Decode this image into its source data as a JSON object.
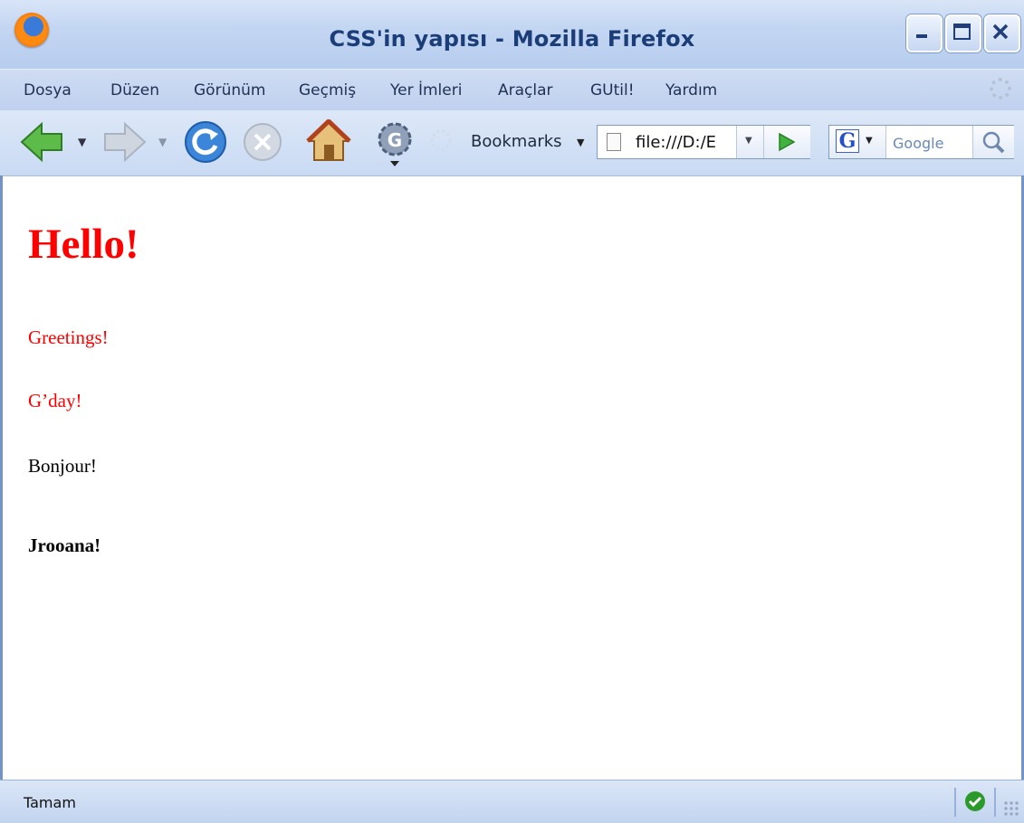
{
  "window": {
    "title": "CSS'in yapısı - Mozilla Firefox",
    "app_icon": "firefox-icon",
    "controls": [
      "minimize-icon",
      "maximize-icon",
      "close-icon"
    ]
  },
  "menu": {
    "items": [
      "Dosya",
      "Düzen",
      "Görünüm",
      "Geçmiş",
      "Yer İmleri",
      "Araçlar",
      "GUtil!",
      "Yardım"
    ]
  },
  "toolbar": {
    "icons": [
      "back-icon",
      "forward-icon",
      "reload-icon",
      "stop-icon",
      "home-icon",
      "gutil-icon",
      "throbber-icon"
    ],
    "bookmarks_label": "Bookmarks",
    "url_value": "file:///D:/E",
    "search_placeholder": "Google",
    "search_engine_icon": "google-icon"
  },
  "page": {
    "heading": "Hello!",
    "p1": "Greetings!",
    "p2": "G’day!",
    "p3": "Bonjour!",
    "p4": "Jrooana!"
  },
  "status": {
    "text": "Tamam",
    "icon": "ok-check-icon"
  },
  "colors": {
    "accent_red": "#ff0000",
    "chrome_blue": "#c3d6f2"
  }
}
